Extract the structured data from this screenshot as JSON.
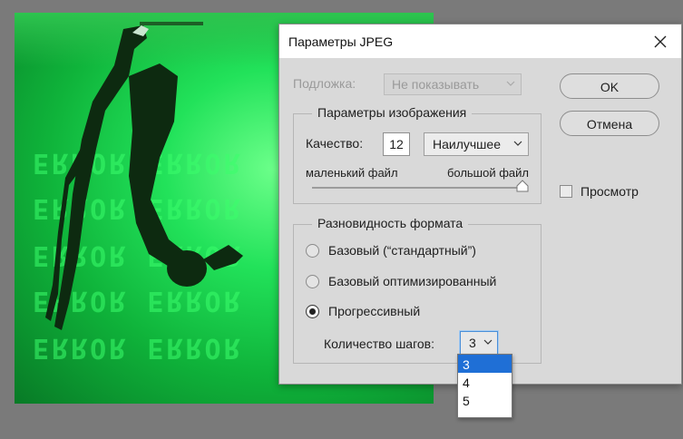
{
  "dialog": {
    "title": "Параметры JPEG",
    "close_icon": "close-icon"
  },
  "backdrop": {
    "label": "Подложка:",
    "value": "Не показывать",
    "enabled": false
  },
  "image_options": {
    "legend": "Параметры изображения",
    "quality_label": "Качество:",
    "quality_value": "12",
    "quality_preset": "Наилучшее",
    "small_file_label": "маленький файл",
    "large_file_label": "большой файл",
    "quality_slider_fraction": 1.0
  },
  "format_options": {
    "legend": "Разновидность формата",
    "options": [
      {
        "label": "Базовый (“стандартный”)",
        "checked": false
      },
      {
        "label": "Базовый оптимизированный",
        "checked": false
      },
      {
        "label": "Прогрессивный",
        "checked": true
      }
    ],
    "scans_label": "Количество шагов:",
    "scans_value": "3"
  },
  "buttons": {
    "ok": "OK",
    "cancel": "Отмена"
  },
  "preview": {
    "label": "Просмотр",
    "checked": false
  },
  "scans_dropdown": {
    "options": [
      "3",
      "4",
      "5"
    ],
    "selected": "3"
  },
  "background_image": {
    "glyph_rows": [
      "ЕRROR ЕRROR",
      "ЕRROR ЕRROR",
      "ЕRROR ЕRROR",
      "ЕRROR ЕRROR",
      "ЕRROR ЕRROR"
    ],
    "accent_color": "#22e25a"
  }
}
